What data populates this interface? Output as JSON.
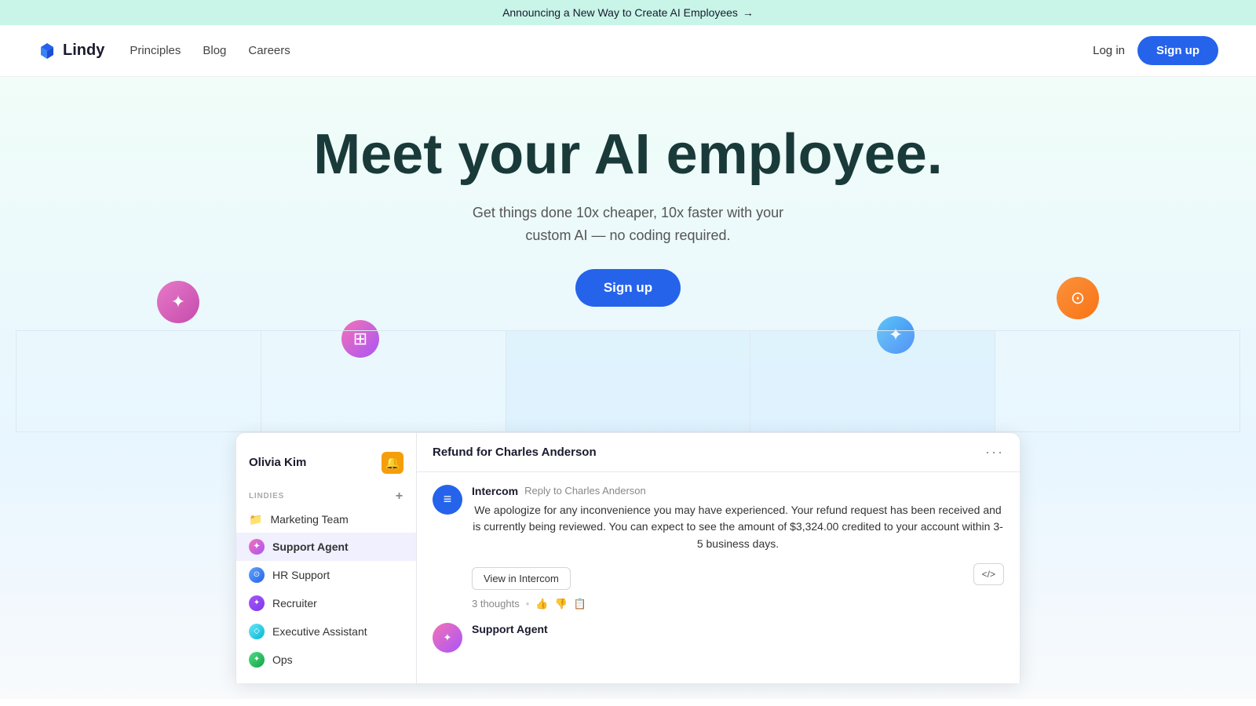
{
  "announcement": {
    "text": "Announcing a New Way to Create AI Employees",
    "arrow": "→"
  },
  "nav": {
    "logo": "Lindy",
    "links": [
      "Principles",
      "Blog",
      "Careers"
    ],
    "login": "Log in",
    "signup": "Sign up"
  },
  "hero": {
    "heading": "Meet your AI employee.",
    "subtext1": "Get things done 10x cheaper, 10x faster with your",
    "subtext2": "custom AI — no coding required.",
    "cta": "Sign up"
  },
  "sidebar": {
    "user": "Olivia Kim",
    "user_emoji": "🔔",
    "section_label": "LINDIES",
    "items": [
      {
        "id": "marketing-team",
        "label": "Marketing Team",
        "icon": "folder",
        "active": false
      },
      {
        "id": "support-agent",
        "label": "Support Agent",
        "icon": "pink",
        "active": true
      },
      {
        "id": "hr-support",
        "label": "HR Support",
        "icon": "blue",
        "active": false
      },
      {
        "id": "recruiter",
        "label": "Recruiter",
        "icon": "purple",
        "active": false
      },
      {
        "id": "executive-assistant",
        "label": "Executive Assistant",
        "icon": "cyan",
        "active": false
      },
      {
        "id": "ops",
        "label": "Ops",
        "icon": "green",
        "active": false
      }
    ]
  },
  "content": {
    "title": "Refund for Charles Anderson",
    "message": {
      "sender": "Intercom",
      "action": "Reply to Charles Anderson",
      "body": "We apologize for any inconvenience you may have experienced. Your refund request has been received and is currently being reviewed. You can expect to see the amount of $3,324.00 credited to your account within 3-5 business days.",
      "view_btn": "View in Intercom",
      "thoughts": "3 thoughts"
    },
    "support_agent": {
      "name": "Support Agent"
    }
  }
}
